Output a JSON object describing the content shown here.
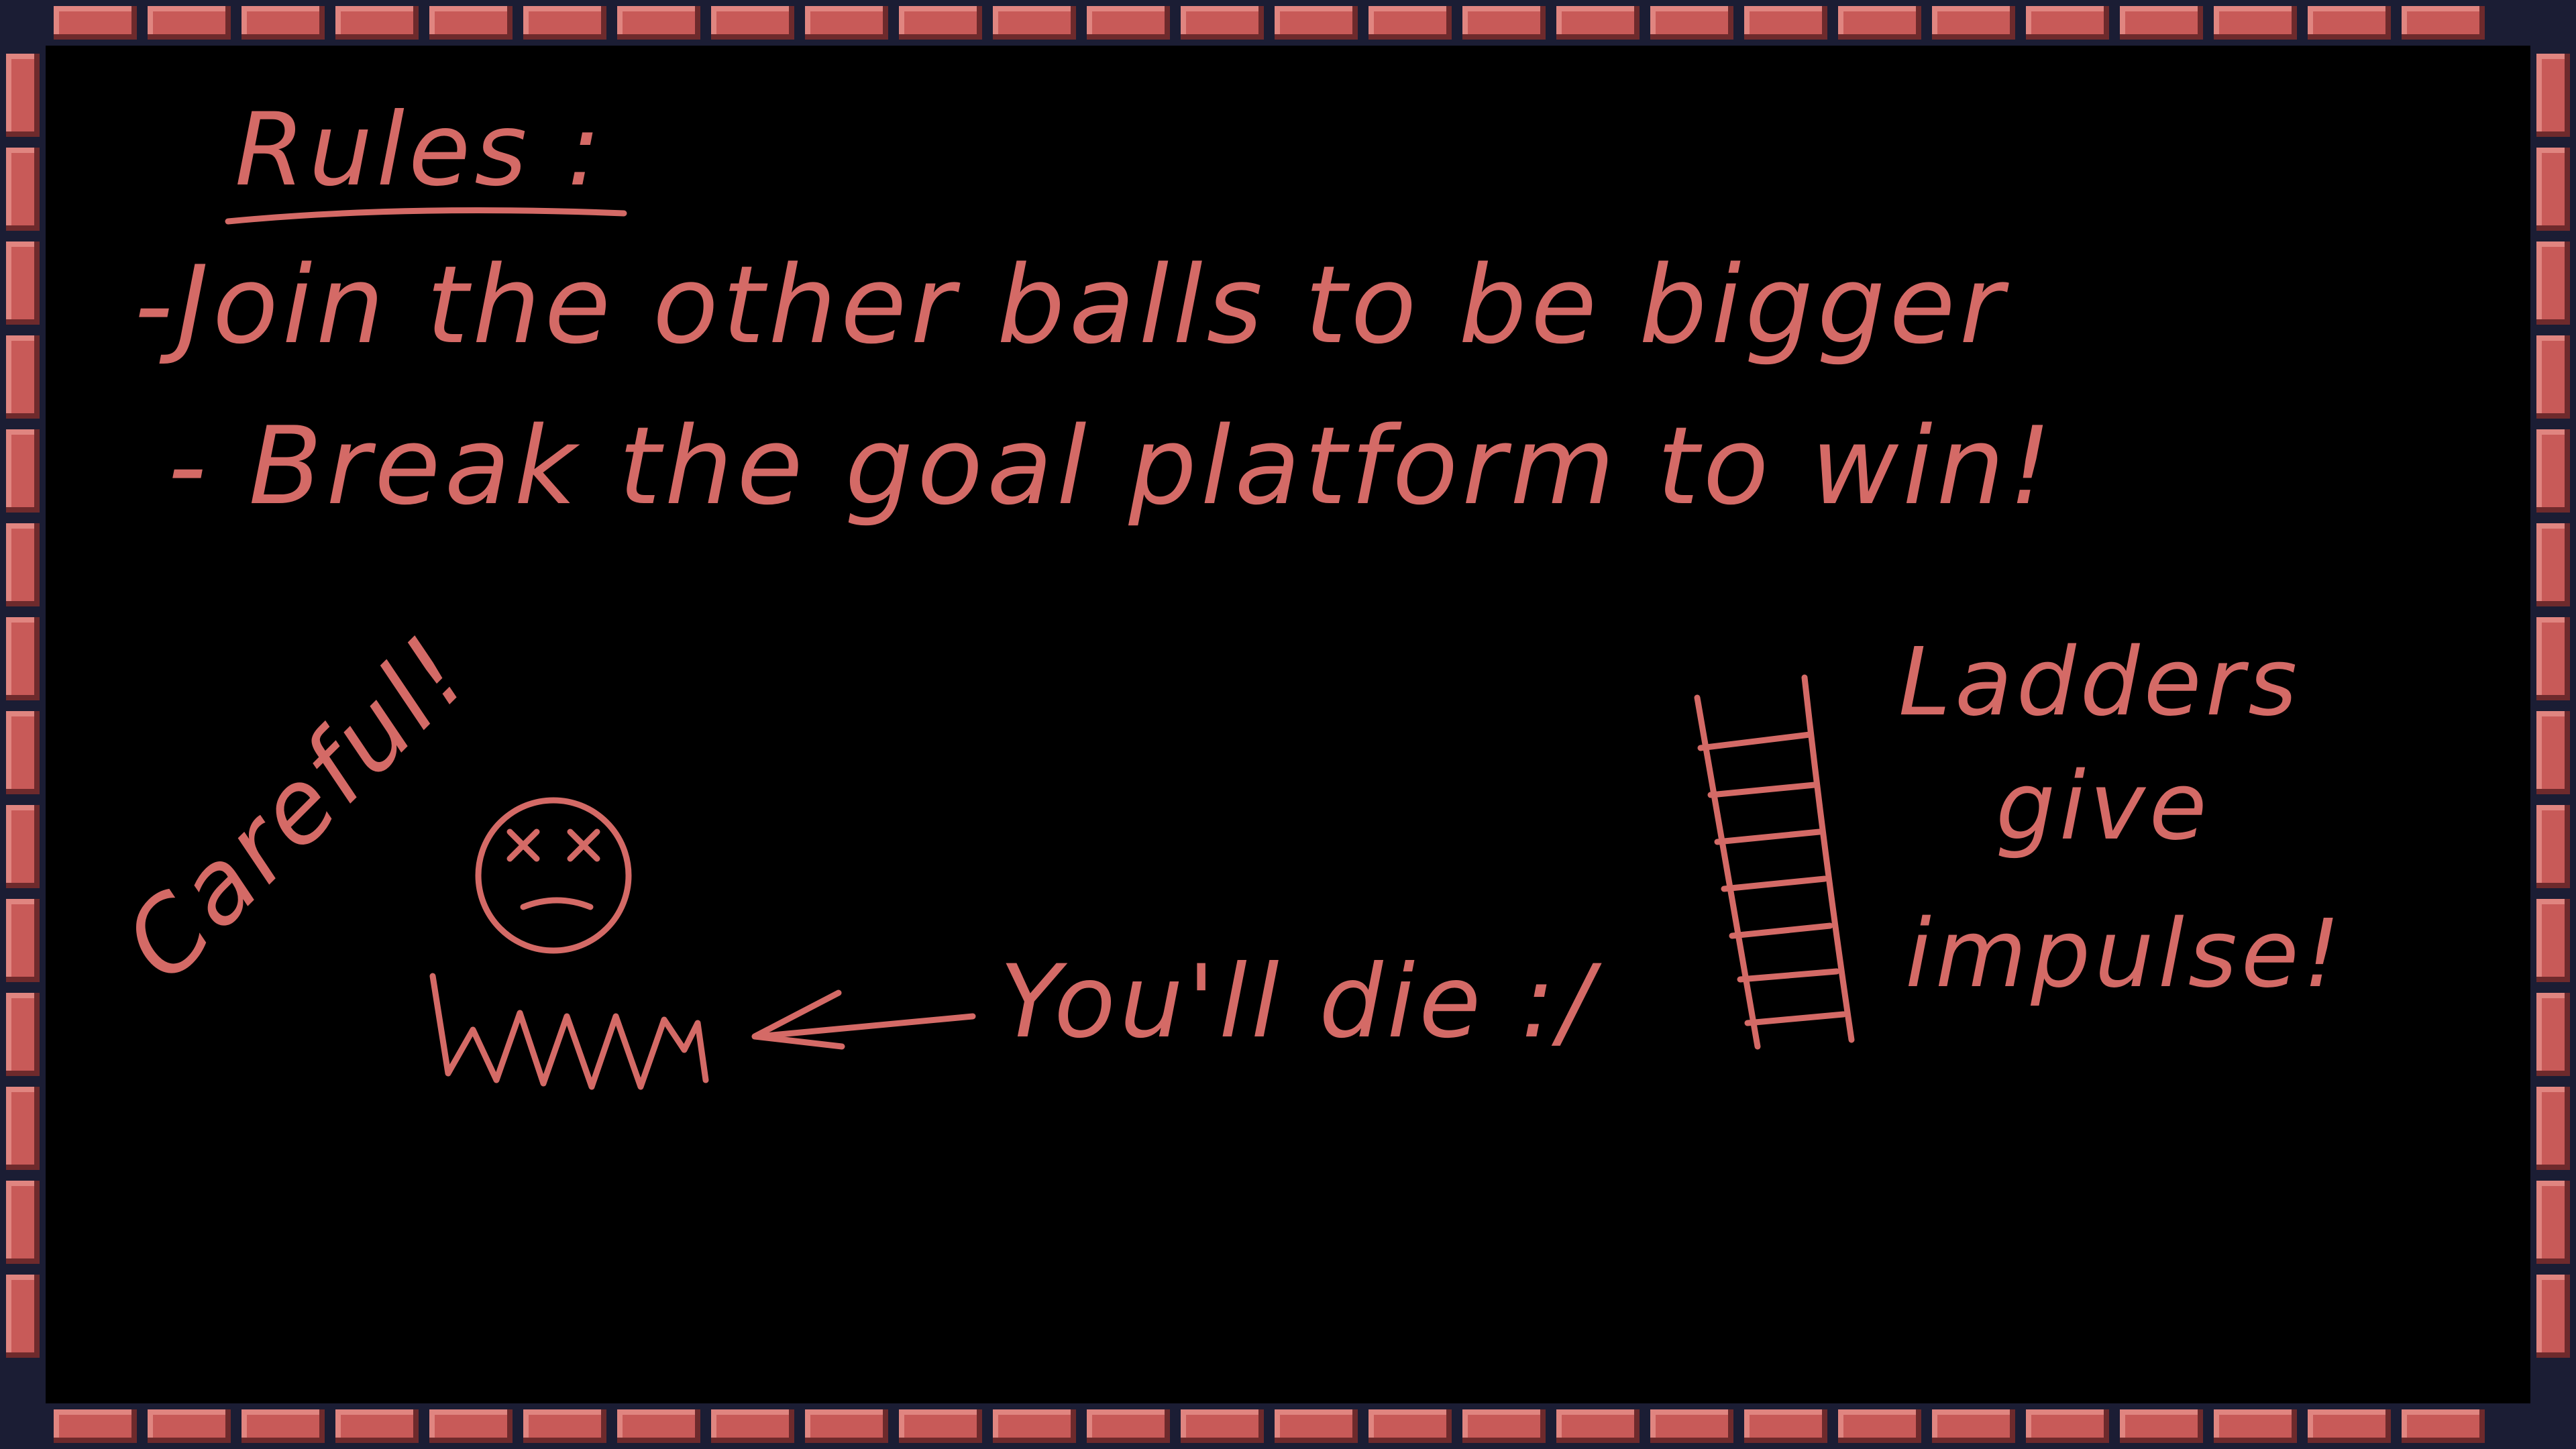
{
  "colors": {
    "background": "#000000",
    "chalk": "#d46a66",
    "brick_fill": "#c85a58",
    "brick_highlight": "#e08580",
    "brick_shadow": "#6e2a2c",
    "mortar": "#1b1d34"
  },
  "board": {
    "heading": "Rules :",
    "rule_1": "-Join the other balls to be bigger",
    "rule_2": "- Break the goal platform to win!",
    "warning": "Careful!",
    "death_note": "You'll die :/",
    "ladder_note": {
      "line_1": "Ladders",
      "line_2": "give",
      "line_3": "impulse!"
    }
  },
  "icons": {
    "dead_face": "dead-face-icon",
    "spikes": "spikes-icon",
    "arrow": "arrow-left-icon",
    "ladder": "ladder-icon"
  }
}
